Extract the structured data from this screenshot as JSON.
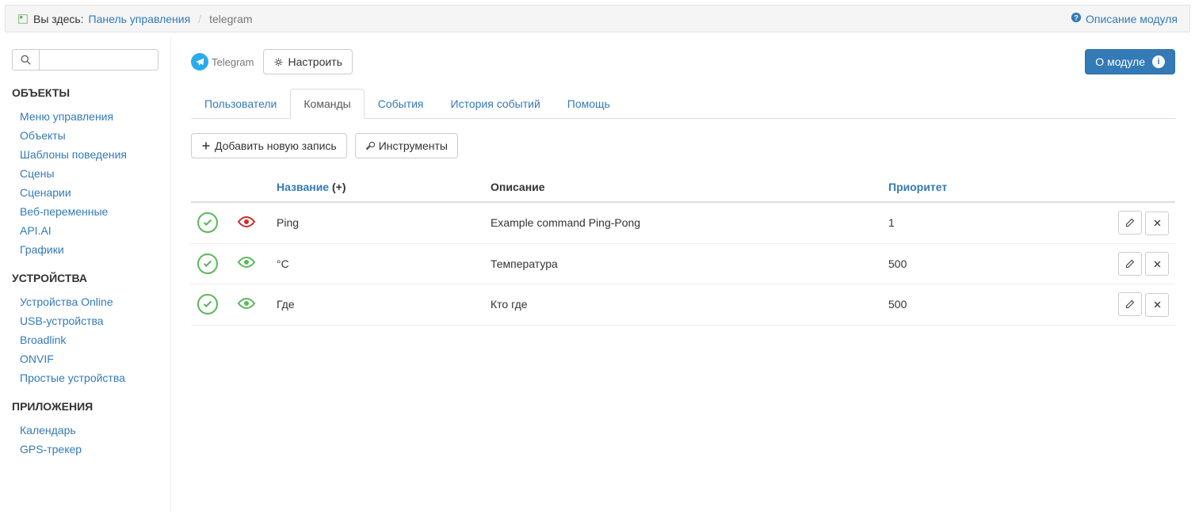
{
  "breadcrumb": {
    "here_label": "Вы здесь:",
    "panel_link": "Панель управления",
    "current": "telegram",
    "help_link": "Описание модуля"
  },
  "sidebar": {
    "sections": [
      {
        "title": "ОБЪЕКТЫ",
        "items": [
          "Меню управления",
          "Объекты",
          "Шаблоны поведения",
          "Сцены",
          "Сценарии",
          "Веб-переменные",
          "API.AI",
          "Графики"
        ]
      },
      {
        "title": "УСТРОЙСТВА",
        "items": [
          "Устройства Online",
          "USB-устройства",
          "Broadlink",
          "ONVIF",
          "Простые устройства"
        ]
      },
      {
        "title": "ПРИЛОЖЕНИЯ",
        "items": [
          "Календарь",
          "GPS-трекер"
        ]
      }
    ]
  },
  "module": {
    "name": "Telegram",
    "configure_btn": "Настроить",
    "about_btn": "О модуле"
  },
  "tabs": [
    {
      "label": "Пользователи",
      "active": false
    },
    {
      "label": "Команды",
      "active": true
    },
    {
      "label": "События",
      "active": false
    },
    {
      "label": "История событий",
      "active": false
    },
    {
      "label": "Помощь",
      "active": false
    }
  ],
  "toolbar": {
    "add_btn": "Добавить новую запись",
    "tools_btn": "Инструменты"
  },
  "table": {
    "headers": {
      "name": "Название",
      "name_suffix": "(+)",
      "description": "Описание",
      "priority": "Приоритет"
    },
    "rows": [
      {
        "name": "Ping",
        "description": "Example command Ping-Pong",
        "priority": "1",
        "eye_color": "red"
      },
      {
        "name": "°C",
        "description": "Температура",
        "priority": "500",
        "eye_color": "green"
      },
      {
        "name": "Где",
        "description": "Кто где",
        "priority": "500",
        "eye_color": "green"
      }
    ]
  }
}
